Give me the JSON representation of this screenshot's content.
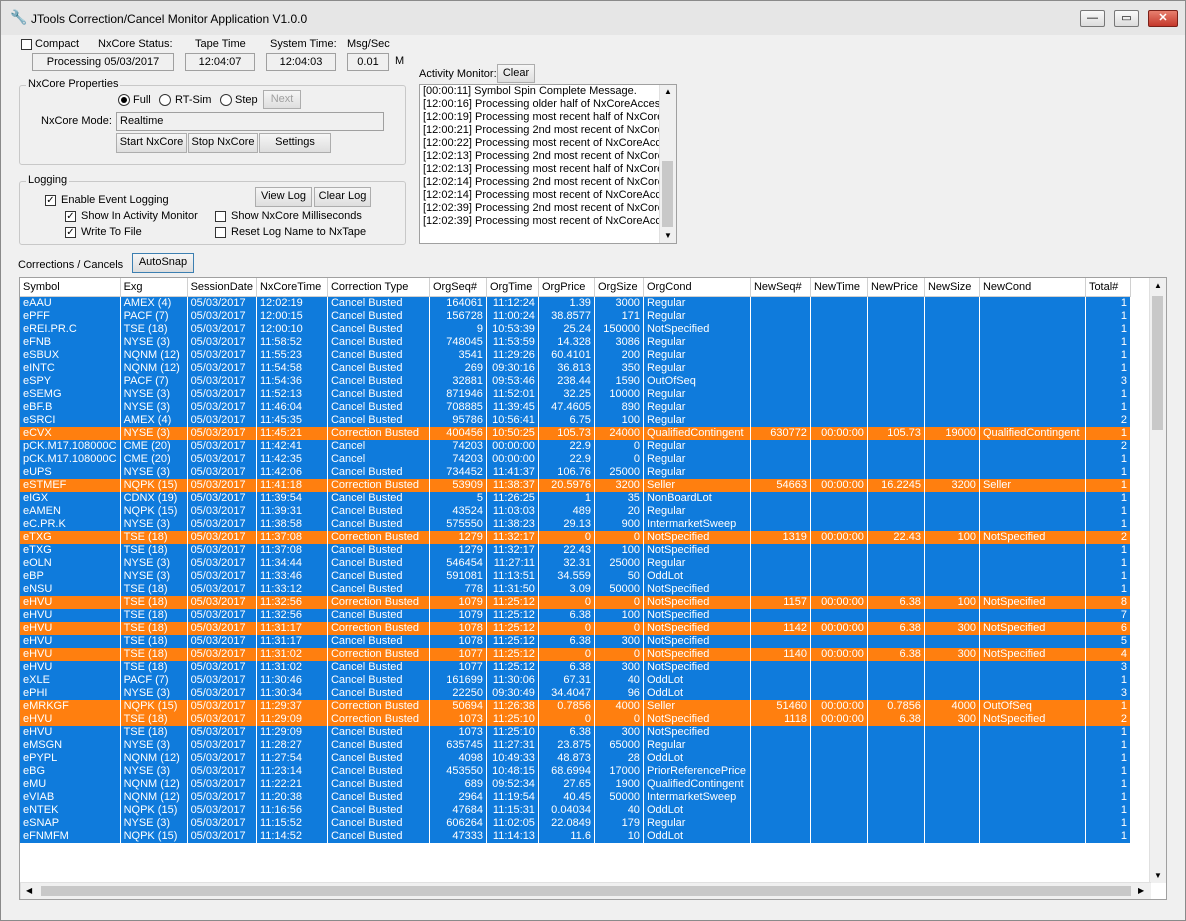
{
  "window": {
    "title": "JTools Correction/Cancel Monitor Application V1.0.0",
    "minimize": "—",
    "maximize": "▭",
    "close": "✕"
  },
  "status": {
    "compact_label": "Compact",
    "nxcore_status_label": "NxCore Status:",
    "nxcore_status_value": "Processing 05/03/2017",
    "tape_time_label": "Tape Time",
    "tape_time_value": "12:04:07",
    "system_time_label": "System Time:",
    "system_time_value": "12:04:03",
    "msg_sec_label": "Msg/Sec",
    "msg_sec_value": "0.01",
    "msg_sec_unit": "M"
  },
  "props": {
    "title": "NxCore Properties",
    "radio_full": "Full",
    "radio_rtsim": "RT-Sim",
    "radio_step": "Step",
    "next_button": "Next",
    "mode_label": "NxCore Mode:",
    "mode_value": "Realtime",
    "start_button": "Start NxCore",
    "stop_button": "Stop NxCore",
    "settings_button": "Settings"
  },
  "logging": {
    "title": "Logging",
    "enable": "Enable Event Logging",
    "show_activity": "Show In Activity Monitor",
    "write_file": "Write To File",
    "show_ms": "Show NxCore Milliseconds",
    "reset_log": "Reset Log Name to NxTape",
    "view_log": "View Log",
    "clear_log": "Clear Log"
  },
  "activity": {
    "label": "Activity Monitor:",
    "clear_button": "Clear",
    "lines": [
      "[00:00:11] Symbol Spin Complete Message.",
      "[12:00:16] Processing older half of NxCoreAccess\\",
      "[12:00:19] Processing most recent half of NxCoreA",
      "[12:00:21] Processing 2nd most recent of NxCoreA",
      "[12:00:22] Processing most recent of NxCoreAcce:",
      "[12:02:13] Processing 2nd most recent of NxCoreA",
      "[12:02:13] Processing most recent half of NxCoreA",
      "[12:02:14] Processing 2nd most recent of NxCoreA",
      "[12:02:14] Processing most recent of NxCoreAcce:",
      "[12:02:39] Processing 2nd most recent of NxCoreA",
      "[12:02:39] Processing most recent of NxCoreAcce:"
    ]
  },
  "corrections": {
    "label": "Corrections / Cancels",
    "autosnap_button": "AutoSnap",
    "columns": [
      "Symbol",
      "Exg",
      "SessionDate",
      "NxCoreTime",
      "Correction Type",
      "OrgSeq#",
      "OrgTime",
      "OrgPrice",
      "OrgSize",
      "OrgCond",
      "NewSeq#",
      "NewTime",
      "NewPrice",
      "NewSize",
      "NewCond",
      "Total#"
    ],
    "rows": [
      {
        "c": "blue",
        "v": [
          "eAAU",
          "AMEX (4)",
          "05/03/2017",
          "12:02:19",
          "Cancel Busted",
          "164061",
          "11:12:24",
          "1.39",
          "3000",
          "Regular",
          "",
          "",
          "",
          "",
          "",
          "1"
        ]
      },
      {
        "c": "blue",
        "v": [
          "ePFF",
          "PACF (7)",
          "05/03/2017",
          "12:00:15",
          "Cancel Busted",
          "156728",
          "11:00:24",
          "38.8577",
          "171",
          "Regular",
          "",
          "",
          "",
          "",
          "",
          "1"
        ]
      },
      {
        "c": "blue",
        "v": [
          "eREI.PR.C",
          "TSE (18)",
          "05/03/2017",
          "12:00:10",
          "Cancel Busted",
          "9",
          "10:53:39",
          "25.24",
          "150000",
          "NotSpecified",
          "",
          "",
          "",
          "",
          "",
          "1"
        ]
      },
      {
        "c": "blue",
        "v": [
          "eFNB",
          "NYSE (3)",
          "05/03/2017",
          "11:58:52",
          "Cancel Busted",
          "748045",
          "11:53:59",
          "14.328",
          "3086",
          "Regular",
          "",
          "",
          "",
          "",
          "",
          "1"
        ]
      },
      {
        "c": "blue",
        "v": [
          "eSBUX",
          "NQNM (12)",
          "05/03/2017",
          "11:55:23",
          "Cancel Busted",
          "3541",
          "11:29:26",
          "60.4101",
          "200",
          "Regular",
          "",
          "",
          "",
          "",
          "",
          "1"
        ]
      },
      {
        "c": "blue",
        "v": [
          "eINTC",
          "NQNM (12)",
          "05/03/2017",
          "11:54:58",
          "Cancel Busted",
          "269",
          "09:30:16",
          "36.813",
          "350",
          "Regular",
          "",
          "",
          "",
          "",
          "",
          "1"
        ]
      },
      {
        "c": "blue",
        "v": [
          "eSPY",
          "PACF (7)",
          "05/03/2017",
          "11:54:36",
          "Cancel Busted",
          "32881",
          "09:53:46",
          "238.44",
          "1590",
          "OutOfSeq",
          "",
          "",
          "",
          "",
          "",
          "3"
        ]
      },
      {
        "c": "blue",
        "v": [
          "eSEMG",
          "NYSE (3)",
          "05/03/2017",
          "11:52:13",
          "Cancel Busted",
          "871946",
          "11:52:01",
          "32.25",
          "10000",
          "Regular",
          "",
          "",
          "",
          "",
          "",
          "1"
        ]
      },
      {
        "c": "blue",
        "v": [
          "eBF.B",
          "NYSE (3)",
          "05/03/2017",
          "11:46:04",
          "Cancel Busted",
          "708885",
          "11:39:45",
          "47.4605",
          "890",
          "Regular",
          "",
          "",
          "",
          "",
          "",
          "1"
        ]
      },
      {
        "c": "blue",
        "v": [
          "eSRCI",
          "AMEX (4)",
          "05/03/2017",
          "11:45:35",
          "Cancel Busted",
          "95786",
          "10:56:41",
          "6.75",
          "100",
          "Regular",
          "",
          "",
          "",
          "",
          "",
          "2"
        ]
      },
      {
        "c": "orange",
        "v": [
          "eCVX",
          "NYSE (3)",
          "05/03/2017",
          "11:45:21",
          "Correction Busted",
          "400456",
          "10:50:25",
          "105.73",
          "24000",
          "QualifiedContingent",
          "630772",
          "00:00:00",
          "105.73",
          "19000",
          "QualifiedContingent",
          "1"
        ]
      },
      {
        "c": "blue",
        "v": [
          "pCK.M17.108000C",
          "CME (20)",
          "05/03/2017",
          "11:42:41",
          "Cancel",
          "74203",
          "00:00:00",
          "22.9",
          "0",
          "Regular",
          "",
          "",
          "",
          "",
          "",
          "2"
        ]
      },
      {
        "c": "blue",
        "v": [
          "pCK.M17.108000C",
          "CME (20)",
          "05/03/2017",
          "11:42:35",
          "Cancel",
          "74203",
          "00:00:00",
          "22.9",
          "0",
          "Regular",
          "",
          "",
          "",
          "",
          "",
          "1"
        ]
      },
      {
        "c": "blue",
        "v": [
          "eUPS",
          "NYSE (3)",
          "05/03/2017",
          "11:42:06",
          "Cancel Busted",
          "734452",
          "11:41:37",
          "106.76",
          "25000",
          "Regular",
          "",
          "",
          "",
          "",
          "",
          "1"
        ]
      },
      {
        "c": "orange",
        "v": [
          "eSTMEF",
          "NQPK (15)",
          "05/03/2017",
          "11:41:18",
          "Correction Busted",
          "53909",
          "11:38:37",
          "20.5976",
          "3200",
          "Seller",
          "54663",
          "00:00:00",
          "16.2245",
          "3200",
          "Seller",
          "1"
        ]
      },
      {
        "c": "blue",
        "v": [
          "eIGX",
          "CDNX (19)",
          "05/03/2017",
          "11:39:54",
          "Cancel Busted",
          "5",
          "11:26:25",
          "1",
          "35",
          "NonBoardLot",
          "",
          "",
          "",
          "",
          "",
          "1"
        ]
      },
      {
        "c": "blue",
        "v": [
          "eAMEN",
          "NQPK (15)",
          "05/03/2017",
          "11:39:31",
          "Cancel Busted",
          "43524",
          "11:03:03",
          "489",
          "20",
          "Regular",
          "",
          "",
          "",
          "",
          "",
          "1"
        ]
      },
      {
        "c": "blue",
        "v": [
          "eC.PR.K",
          "NYSE (3)",
          "05/03/2017",
          "11:38:58",
          "Cancel Busted",
          "575550",
          "11:38:23",
          "29.13",
          "900",
          "IntermarketSweep",
          "",
          "",
          "",
          "",
          "",
          "1"
        ]
      },
      {
        "c": "orange",
        "v": [
          "eTXG",
          "TSE (18)",
          "05/03/2017",
          "11:37:08",
          "Correction Busted",
          "1279",
          "11:32:17",
          "0",
          "0",
          "NotSpecified",
          "1319",
          "00:00:00",
          "22.43",
          "100",
          "NotSpecified",
          "2"
        ]
      },
      {
        "c": "blue",
        "v": [
          "eTXG",
          "TSE (18)",
          "05/03/2017",
          "11:37:08",
          "Cancel Busted",
          "1279",
          "11:32:17",
          "22.43",
          "100",
          "NotSpecified",
          "",
          "",
          "",
          "",
          "",
          "1"
        ]
      },
      {
        "c": "blue",
        "v": [
          "eOLN",
          "NYSE (3)",
          "05/03/2017",
          "11:34:44",
          "Cancel Busted",
          "546454",
          "11:27:11",
          "32.31",
          "25000",
          "Regular",
          "",
          "",
          "",
          "",
          "",
          "1"
        ]
      },
      {
        "c": "blue",
        "v": [
          "eBP",
          "NYSE (3)",
          "05/03/2017",
          "11:33:46",
          "Cancel Busted",
          "591081",
          "11:13:51",
          "34.559",
          "50",
          "OddLot",
          "",
          "",
          "",
          "",
          "",
          "1"
        ]
      },
      {
        "c": "blue",
        "v": [
          "eNSU",
          "TSE (18)",
          "05/03/2017",
          "11:33:12",
          "Cancel Busted",
          "778",
          "11:31:50",
          "3.09",
          "50000",
          "NotSpecified",
          "",
          "",
          "",
          "",
          "",
          "1"
        ]
      },
      {
        "c": "orange",
        "v": [
          "eHVU",
          "TSE (18)",
          "05/03/2017",
          "11:32:56",
          "Correction Busted",
          "1079",
          "11:25:12",
          "0",
          "0",
          "NotSpecified",
          "1157",
          "00:00:00",
          "6.38",
          "100",
          "NotSpecified",
          "8"
        ]
      },
      {
        "c": "blue",
        "v": [
          "eHVU",
          "TSE (18)",
          "05/03/2017",
          "11:32:56",
          "Cancel Busted",
          "1079",
          "11:25:12",
          "6.38",
          "100",
          "NotSpecified",
          "",
          "",
          "",
          "",
          "",
          "7"
        ]
      },
      {
        "c": "orange",
        "v": [
          "eHVU",
          "TSE (18)",
          "05/03/2017",
          "11:31:17",
          "Correction Busted",
          "1078",
          "11:25:12",
          "0",
          "0",
          "NotSpecified",
          "1142",
          "00:00:00",
          "6.38",
          "300",
          "NotSpecified",
          "6"
        ]
      },
      {
        "c": "blue",
        "v": [
          "eHVU",
          "TSE (18)",
          "05/03/2017",
          "11:31:17",
          "Cancel Busted",
          "1078",
          "11:25:12",
          "6.38",
          "300",
          "NotSpecified",
          "",
          "",
          "",
          "",
          "",
          "5"
        ]
      },
      {
        "c": "orange",
        "v": [
          "eHVU",
          "TSE (18)",
          "05/03/2017",
          "11:31:02",
          "Correction Busted",
          "1077",
          "11:25:12",
          "0",
          "0",
          "NotSpecified",
          "1140",
          "00:00:00",
          "6.38",
          "300",
          "NotSpecified",
          "4"
        ]
      },
      {
        "c": "blue",
        "v": [
          "eHVU",
          "TSE (18)",
          "05/03/2017",
          "11:31:02",
          "Cancel Busted",
          "1077",
          "11:25:12",
          "6.38",
          "300",
          "NotSpecified",
          "",
          "",
          "",
          "",
          "",
          "3"
        ]
      },
      {
        "c": "blue",
        "v": [
          "eXLE",
          "PACF (7)",
          "05/03/2017",
          "11:30:46",
          "Cancel Busted",
          "161699",
          "11:30:06",
          "67.31",
          "40",
          "OddLot",
          "",
          "",
          "",
          "",
          "",
          "1"
        ]
      },
      {
        "c": "blue",
        "v": [
          "ePHI",
          "NYSE (3)",
          "05/03/2017",
          "11:30:34",
          "Cancel Busted",
          "22250",
          "09:30:49",
          "34.4047",
          "96",
          "OddLot",
          "",
          "",
          "",
          "",
          "",
          "3"
        ]
      },
      {
        "c": "orange",
        "v": [
          "eMRKGF",
          "NQPK (15)",
          "05/03/2017",
          "11:29:37",
          "Correction Busted",
          "50694",
          "11:26:38",
          "0.7856",
          "4000",
          "Seller",
          "51460",
          "00:00:00",
          "0.7856",
          "4000",
          "OutOfSeq",
          "1"
        ]
      },
      {
        "c": "orange",
        "v": [
          "eHVU",
          "TSE (18)",
          "05/03/2017",
          "11:29:09",
          "Correction Busted",
          "1073",
          "11:25:10",
          "0",
          "0",
          "NotSpecified",
          "1118",
          "00:00:00",
          "6.38",
          "300",
          "NotSpecified",
          "2"
        ]
      },
      {
        "c": "blue",
        "v": [
          "eHVU",
          "TSE (18)",
          "05/03/2017",
          "11:29:09",
          "Cancel Busted",
          "1073",
          "11:25:10",
          "6.38",
          "300",
          "NotSpecified",
          "",
          "",
          "",
          "",
          "",
          "1"
        ]
      },
      {
        "c": "blue",
        "v": [
          "eMSGN",
          "NYSE (3)",
          "05/03/2017",
          "11:28:27",
          "Cancel Busted",
          "635745",
          "11:27:31",
          "23.875",
          "65000",
          "Regular",
          "",
          "",
          "",
          "",
          "",
          "1"
        ]
      },
      {
        "c": "blue",
        "v": [
          "ePYPL",
          "NQNM (12)",
          "05/03/2017",
          "11:27:54",
          "Cancel Busted",
          "4098",
          "10:49:33",
          "48.873",
          "28",
          "OddLot",
          "",
          "",
          "",
          "",
          "",
          "1"
        ]
      },
      {
        "c": "blue",
        "v": [
          "eBG",
          "NYSE (3)",
          "05/03/2017",
          "11:23:14",
          "Cancel Busted",
          "453550",
          "10:48:15",
          "68.6994",
          "17000",
          "PriorReferencePrice",
          "",
          "",
          "",
          "",
          "",
          "1"
        ]
      },
      {
        "c": "blue",
        "v": [
          "eMU",
          "NQNM (12)",
          "05/03/2017",
          "11:22:21",
          "Cancel Busted",
          "689",
          "09:52:34",
          "27.65",
          "1900",
          "QualifiedContingent",
          "",
          "",
          "",
          "",
          "",
          "1"
        ]
      },
      {
        "c": "blue",
        "v": [
          "eVIAB",
          "NQNM (12)",
          "05/03/2017",
          "11:20:38",
          "Cancel Busted",
          "2964",
          "11:19:54",
          "40.45",
          "50000",
          "IntermarketSweep",
          "",
          "",
          "",
          "",
          "",
          "1"
        ]
      },
      {
        "c": "blue",
        "v": [
          "eNTEK",
          "NQPK (15)",
          "05/03/2017",
          "11:16:56",
          "Cancel Busted",
          "47684",
          "11:15:31",
          "0.04034",
          "40",
          "OddLot",
          "",
          "",
          "",
          "",
          "",
          "1"
        ]
      },
      {
        "c": "blue",
        "v": [
          "eSNAP",
          "NYSE (3)",
          "05/03/2017",
          "11:15:52",
          "Cancel Busted",
          "606264",
          "11:02:05",
          "22.0849",
          "179",
          "Regular",
          "",
          "",
          "",
          "",
          "",
          "1"
        ]
      },
      {
        "c": "blue",
        "v": [
          "eFNMFM",
          "NQPK (15)",
          "05/03/2017",
          "11:14:52",
          "Cancel Busted",
          "47333",
          "11:14:13",
          "11.6",
          "10",
          "OddLot",
          "",
          "",
          "",
          "",
          "",
          "1"
        ]
      }
    ]
  }
}
